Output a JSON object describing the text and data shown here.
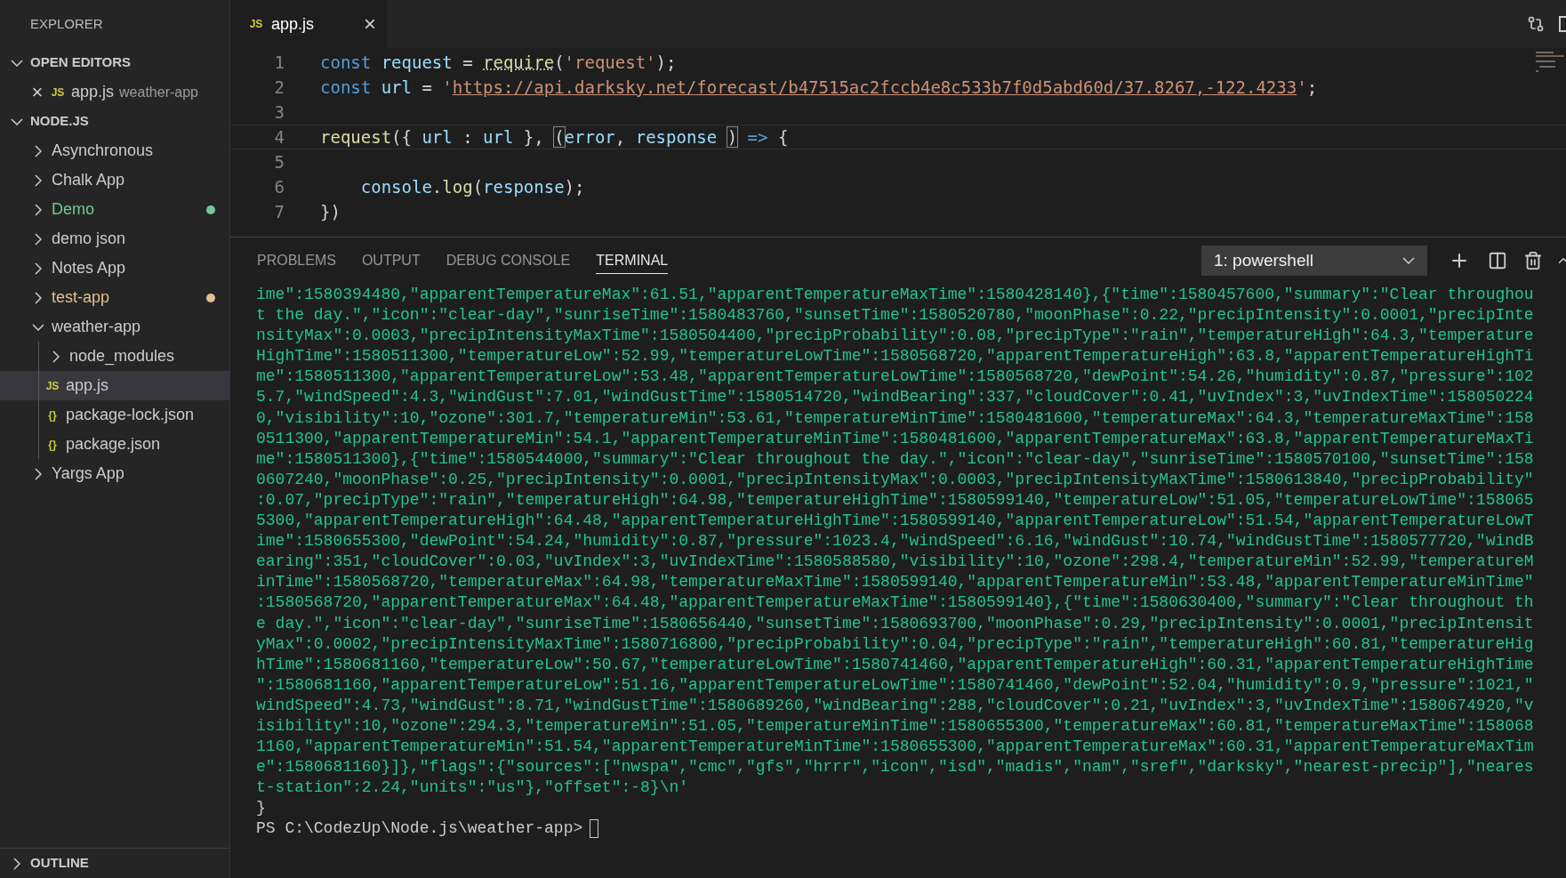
{
  "sidebar": {
    "title": "EXPLORER",
    "open_editors": {
      "label": "OPEN EDITORS",
      "expanded": true,
      "items": [
        {
          "close": "×",
          "badge": "JS",
          "name": "app.js",
          "folder": "weather-app"
        }
      ]
    },
    "workspace": {
      "label": "NODE.JS",
      "expanded": true,
      "children": [
        {
          "kind": "folder",
          "name": "Asynchronous",
          "expanded": false,
          "selected": false
        },
        {
          "kind": "folder",
          "name": "Chalk App",
          "expanded": false,
          "selected": false
        },
        {
          "kind": "folder",
          "name": "Demo",
          "expanded": false,
          "selected": false,
          "color": "#73c991"
        },
        {
          "kind": "folder",
          "name": "demo json",
          "expanded": false,
          "selected": false
        },
        {
          "kind": "folder",
          "name": "Notes App",
          "expanded": false,
          "selected": false
        },
        {
          "kind": "folder",
          "name": "test-app",
          "expanded": false,
          "selected": false,
          "color": "#e2c08d"
        },
        {
          "kind": "folder",
          "name": "weather-app",
          "expanded": true,
          "selected": false,
          "children": [
            {
              "kind": "folder",
              "name": "node_modules",
              "expanded": false,
              "selected": false
            },
            {
              "kind": "js",
              "badge": "JS",
              "name": "app.js",
              "selected": true
            },
            {
              "kind": "json",
              "badge": "{}",
              "name": "package-lock.json",
              "selected": false
            },
            {
              "kind": "json",
              "badge": "{}",
              "name": "package.json",
              "selected": false
            }
          ]
        },
        {
          "kind": "folder",
          "name": "Yargs App",
          "expanded": false,
          "selected": false
        }
      ]
    },
    "outline": {
      "label": "OUTLINE",
      "expanded": false
    }
  },
  "editor": {
    "tab": {
      "badge": "JS",
      "name": "app.js",
      "close": "×"
    },
    "lines": [
      {
        "number": "1",
        "tokens": [
          {
            "text": "const ",
            "kind": "kw"
          },
          {
            "text": "request",
            "kind": "var"
          },
          {
            "text": " = ",
            "kind": "plain"
          },
          {
            "text": "require",
            "kind": "fn-dotted"
          },
          {
            "text": "(",
            "kind": "plain"
          },
          {
            "text": "'request'",
            "kind": "str"
          },
          {
            "text": ");",
            "kind": "plain"
          }
        ]
      },
      {
        "number": "2",
        "tokens": [
          {
            "text": "const ",
            "kind": "kw"
          },
          {
            "text": "url",
            "kind": "var"
          },
          {
            "text": " = ",
            "kind": "plain"
          },
          {
            "text": "'",
            "kind": "str"
          },
          {
            "text": "https://api.darksky.net/forecast/b47515ac2fccb4e8c533b7f0d5abd60d/37.8267,-122.4233",
            "kind": "link"
          },
          {
            "text": "'",
            "kind": "str"
          },
          {
            "text": ";",
            "kind": "plain"
          }
        ]
      },
      {
        "number": "3"
      },
      {
        "number": "4",
        "current": true,
        "tokens": [
          {
            "text": "request",
            "kind": "fn"
          },
          {
            "text": "({ ",
            "kind": "plain"
          },
          {
            "text": "url",
            "kind": "var"
          },
          {
            "text": " : ",
            "kind": "plain"
          },
          {
            "text": "url",
            "kind": "var"
          },
          {
            "text": " }, ",
            "kind": "plain"
          },
          {
            "text": "(",
            "kind": "match"
          },
          {
            "text": "error",
            "kind": "var"
          },
          {
            "text": ", ",
            "kind": "plain"
          },
          {
            "text": "response ",
            "kind": "var"
          },
          {
            "text": ")",
            "kind": "match"
          },
          {
            "text": " =>",
            "kind": "kw"
          },
          {
            "text": " {",
            "kind": "plain"
          }
        ]
      },
      {
        "number": "5"
      },
      {
        "number": "6",
        "tokens": [
          {
            "text": "    console",
            "kind": "var"
          },
          {
            "text": ".",
            "kind": "plain"
          },
          {
            "text": "log",
            "kind": "fn"
          },
          {
            "text": "(",
            "kind": "plain"
          },
          {
            "text": "response",
            "kind": "var"
          },
          {
            "text": ");",
            "kind": "plain"
          }
        ]
      },
      {
        "number": "7",
        "tokens": [
          {
            "text": "})",
            "kind": "plain"
          }
        ]
      }
    ]
  },
  "panel": {
    "tabs": [
      {
        "label": "PROBLEMS",
        "selected": false
      },
      {
        "label": "OUTPUT",
        "selected": false
      },
      {
        "label": "DEBUG CONSOLE",
        "selected": false
      },
      {
        "label": "TERMINAL",
        "selected": true
      }
    ],
    "terminal_select": "1: powershell",
    "output": [
      "ime\":1580394480,\"apparentTemperatureMax\":61.51,\"apparentTemperatureMaxTime\":1580428140},{\"time\":1580457600,\"summary\":\"Clear throughou",
      "t the day.\",\"icon\":\"clear-day\",\"sunriseTime\":1580483760,\"sunsetTime\":1580520780,\"moonPhase\":0.22,\"precipIntensity\":0.0001,\"precipInte",
      "nsityMax\":0.0003,\"precipIntensityMaxTime\":1580504400,\"precipProbability\":0.08,\"precipType\":\"rain\",\"temperatureHigh\":64.3,\"temperature",
      "HighTime\":1580511300,\"temperatureLow\":52.99,\"temperatureLowTime\":1580568720,\"apparentTemperatureHigh\":63.8,\"apparentTemperatureHighTi",
      "me\":1580511300,\"apparentTemperatureLow\":53.48,\"apparentTemperatureLowTime\":1580568720,\"dewPoint\":54.26,\"humidity\":0.87,\"pressure\":102",
      "5.7,\"windSpeed\":4.3,\"windGust\":7.01,\"windGustTime\":1580514720,\"windBearing\":337,\"cloudCover\":0.41,\"uvIndex\":3,\"uvIndexTime\":158050224",
      "0,\"visibility\":10,\"ozone\":301.7,\"temperatureMin\":53.61,\"temperatureMinTime\":1580481600,\"temperatureMax\":64.3,\"temperatureMaxTime\":158",
      "0511300,\"apparentTemperatureMin\":54.1,\"apparentTemperatureMinTime\":1580481600,\"apparentTemperatureMax\":63.8,\"apparentTemperatureMaxTi",
      "me\":1580511300},{\"time\":1580544000,\"summary\":\"Clear throughout the day.\",\"icon\":\"clear-day\",\"sunriseTime\":1580570100,\"sunsetTime\":158",
      "0607240,\"moonPhase\":0.25,\"precipIntensity\":0.0001,\"precipIntensityMax\":0.0003,\"precipIntensityMaxTime\":1580613840,\"precipProbability\"",
      ":0.07,\"precipType\":\"rain\",\"temperatureHigh\":64.98,\"temperatureHighTime\":1580599140,\"temperatureLow\":51.05,\"temperatureLowTime\":158065",
      "5300,\"apparentTemperatureHigh\":64.48,\"apparentTemperatureHighTime\":1580599140,\"apparentTemperatureLow\":51.54,\"apparentTemperatureLowT",
      "ime\":1580655300,\"dewPoint\":54.24,\"humidity\":0.87,\"pressure\":1023.4,\"windSpeed\":6.16,\"windGust\":10.74,\"windGustTime\":1580577720,\"windB",
      "earing\":351,\"cloudCover\":0.03,\"uvIndex\":3,\"uvIndexTime\":1580588580,\"visibility\":10,\"ozone\":298.4,\"temperatureMin\":52.99,\"temperatureM",
      "inTime\":1580568720,\"temperatureMax\":64.98,\"temperatureMaxTime\":1580599140,\"apparentTemperatureMin\":53.48,\"apparentTemperatureMinTime\"",
      ":1580568720,\"apparentTemperatureMax\":64.48,\"apparentTemperatureMaxTime\":1580599140},{\"time\":1580630400,\"summary\":\"Clear throughout th",
      "e day.\",\"icon\":\"clear-day\",\"sunriseTime\":1580656440,\"sunsetTime\":1580693700,\"moonPhase\":0.29,\"precipIntensity\":0.0001,\"precipIntensit",
      "yMax\":0.0002,\"precipIntensityMaxTime\":1580716800,\"precipProbability\":0.04,\"precipType\":\"rain\",\"temperatureHigh\":60.81,\"temperatureHig",
      "hTime\":1580681160,\"temperatureLow\":50.67,\"temperatureLowTime\":1580741460,\"apparentTemperatureHigh\":60.31,\"apparentTemperatureHighTime",
      "\":1580681160,\"apparentTemperatureLow\":51.16,\"apparentTemperatureLowTime\":1580741460,\"dewPoint\":52.04,\"humidity\":0.9,\"pressure\":1021,\"",
      "windSpeed\":4.73,\"windGust\":8.71,\"windGustTime\":1580689260,\"windBearing\":288,\"cloudCover\":0.21,\"uvIndex\":3,\"uvIndexTime\":1580674920,\"v",
      "isibility\":10,\"ozone\":294.3,\"temperatureMin\":51.05,\"temperatureMinTime\":1580655300,\"temperatureMax\":60.81,\"temperatureMaxTime\":158068",
      "1160,\"apparentTemperatureMin\":51.54,\"apparentTemperatureMinTime\":1580655300,\"apparentTemperatureMax\":60.31,\"apparentTemperatureMaxTim",
      "e\":1580681160}]},\"flags\":{\"sources\":[\"nwspa\",\"cmc\",\"gfs\",\"hrrr\",\"icon\",\"isd\",\"madis\",\"nam\",\"sref\",\"darksky\",\"nearest-precip\"],\"neares",
      "t-station\":2.24,\"units\":\"us\"},\"offset\":-8}\\n'"
    ],
    "closing": "}",
    "prompt": "PS C:\\CodezUp\\Node.js\\weather-app>"
  }
}
